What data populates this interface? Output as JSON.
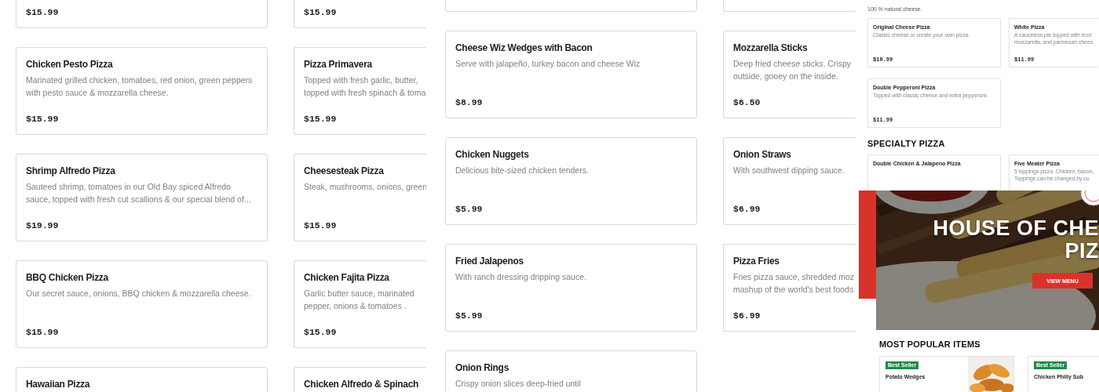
{
  "left_view": {
    "columns": [
      [
        {
          "kind": "item",
          "price": "$15.99"
        },
        {
          "kind": "item",
          "name": "Chicken Pesto Pizza",
          "description": [
            "Marinated grilled chicken, tomatoes, red onion, green peppers",
            "with pesto sauce & mozzarella cheese."
          ],
          "price": "$15.99"
        },
        {
          "kind": "item",
          "name": "Shrimp Alfredo Pizza",
          "description": [
            "Sauteed shrimp, tomatoes in our Old Bay spiced Alfredo",
            "sauce, topped with fresh cut scallions & our special blend of..."
          ],
          "price": "$19.99"
        },
        {
          "kind": "item",
          "name": "BBQ Chicken Pizza",
          "description": [
            "Our secret sauce, onions, BBQ chicken & mozzarella cheese."
          ],
          "price": "$15.99"
        },
        {
          "kind": "item",
          "name": "Hawaiian Pizza"
        }
      ],
      [
        {
          "kind": "item",
          "price": "$15.99"
        },
        {
          "kind": "item",
          "name": "Pizza Primavera",
          "description": [
            "Topped with fresh garlic, butter,",
            "topped with fresh spinach & toma"
          ],
          "price": "$15.99"
        },
        {
          "kind": "item",
          "name": "Cheesesteak Pizza",
          "description": [
            "Steak, mushrooms, onions, green"
          ],
          "price": "$15.99"
        },
        {
          "kind": "item",
          "name": "Chicken Fajita Pizza",
          "description": [
            "Garlic butter sauce, marinated",
            "pepper, onions & tomatoes ."
          ],
          "price": "$15.99"
        },
        {
          "kind": "item",
          "name": "Chicken Alfredo & Spinach"
        }
      ]
    ]
  },
  "middle_view": {
    "columns": [
      [
        {
          "kind": "blank"
        },
        {
          "kind": "item",
          "name": "Cheese Wiz Wedges with Bacon",
          "description": [
            "Serve with jalapeño, turkey bacon and cheese Wiz"
          ],
          "price": "$8.99"
        },
        {
          "kind": "item",
          "name": "Chicken Nuggets",
          "description": [
            "Delicious bite-sized chicken tenders."
          ],
          "price": "$5.99"
        },
        {
          "kind": "item",
          "name": "Fried Jalapenos",
          "description": [
            "With ranch dressing dripping sauce."
          ],
          "price": "$5.99"
        },
        {
          "kind": "item",
          "name": "Onion Rings",
          "description": [
            "Crispy onion slices deep-fried until"
          ]
        }
      ],
      [
        {
          "kind": "blank"
        },
        {
          "kind": "item",
          "name": "Mozzarella Sticks",
          "description": [
            "Deep fried cheese sticks. Crispy",
            "outside, gooey on the inside."
          ],
          "price": "$6.50"
        },
        {
          "kind": "item",
          "name": "Onion Straws",
          "description": [
            "With southwest dipping sauce."
          ],
          "price": "$6.99"
        },
        {
          "kind": "item",
          "name": "Pizza Fries",
          "description": [
            "Fries pizza sauce, shredded moz",
            "mashup of the world's best foods"
          ],
          "price": "$6.99"
        }
      ]
    ]
  },
  "right_view": {
    "subtitle": "100 % natural cheese.",
    "pizza_cards": [
      {
        "name": "Original Cheese Pizza",
        "description": [
          "Classic cheese or create your own pizza."
        ],
        "price": "$10.99"
      },
      {
        "name": "White Pizza",
        "description": [
          "A sauceless pie topped with ricot",
          "mozzarella, and parmesan chees"
        ],
        "price": "$11.99"
      },
      {
        "name": "Double Pepperoni Pizza",
        "description": [
          "Topped with classic cheese and extra pepperoni."
        ],
        "price": "$11.99"
      }
    ],
    "specialty_heading": "SPECIALTY PIZZA",
    "specialty_cards": [
      {
        "name": "Double Chicken & Jalapeno Pizza"
      },
      {
        "name": "Five Meater Pizza",
        "description": [
          "5 toppings pizza. Chicken, bacon,",
          "Toppings can be changed by cu"
        ]
      }
    ],
    "hero": {
      "headline": [
        "HOUSE OF CHE",
        "PIZ"
      ],
      "button": "VIEW MENU"
    },
    "popular_heading": "MOST POPULAR ITEMS",
    "popular_items": [
      {
        "badge": "Best Seller",
        "name": "Potato Wedges",
        "photo": true
      },
      {
        "badge": "Best Seller",
        "name": "Chicken Philly Sub",
        "photo": false
      }
    ]
  }
}
